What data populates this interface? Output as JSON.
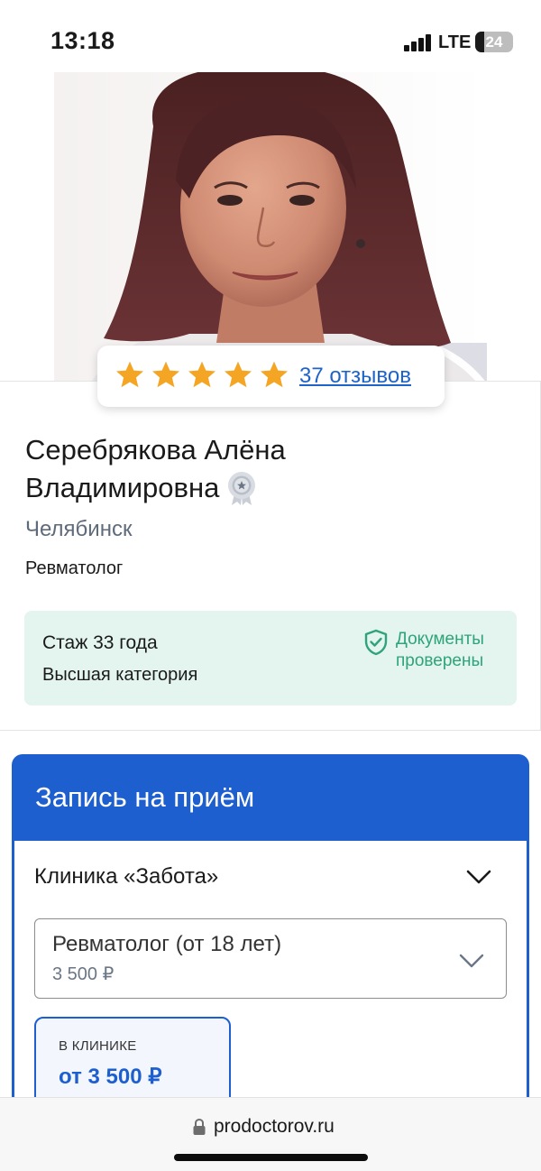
{
  "status_bar": {
    "time": "13:18",
    "network": "LTE",
    "battery": "24",
    "battery_level_percent": 24
  },
  "doctor": {
    "photo": "doctor-portrait",
    "rating": {
      "stars": 5,
      "star_color": "#f5a524",
      "reviews_link": "37 отзывов"
    },
    "name_line1": "Серебрякова Алёна",
    "name_line2": "Владимировна",
    "badge_icon": "medal-icon",
    "city": "Челябинск",
    "specialty": "Ревматолог",
    "experience": "Стаж 33 года",
    "category": "Высшая категория",
    "verified_icon": "shield-check-icon",
    "verified_text_line1": "Документы",
    "verified_text_line2": "проверены"
  },
  "booking": {
    "title": "Запись на приём",
    "clinic": "Клиника «Забота»",
    "service": {
      "name": "Ревматолог (от 18 лет)",
      "price": "3 500 ₽"
    },
    "visit_option": {
      "type": "В КЛИНИКЕ",
      "price": "от 3 500 ₽"
    }
  },
  "browser": {
    "url": "prodoctorov.ru",
    "lock_icon": "lock-icon"
  },
  "colors": {
    "brand_blue": "#1d5fcf",
    "link_blue": "#1e63c8",
    "success_green": "#2fa37a",
    "info_bg": "#e3f5ee",
    "star": "#f5a524"
  }
}
